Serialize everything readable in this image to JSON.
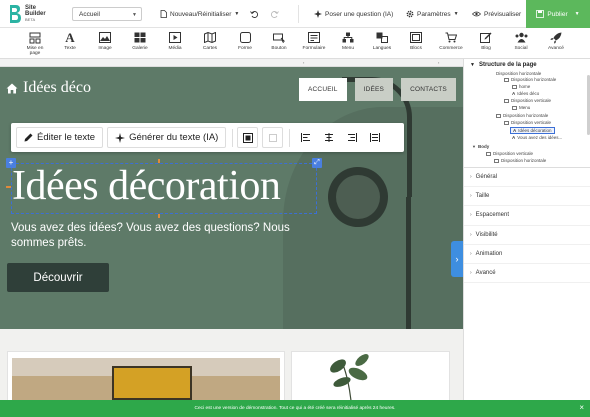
{
  "app": {
    "logo_line1": "Site",
    "logo_line2": "Builder",
    "logo_line3": "BETA"
  },
  "topbar": {
    "page_select": "Accueil",
    "new_reinit": "Nouveau/Réinitialiser",
    "ask_question": "Poser une question (IA)",
    "settings": "Paramètres",
    "preview": "Prévisualiser",
    "publish": "Publier"
  },
  "tools": [
    {
      "label": "Mise en page",
      "icon": "layout-icon"
    },
    {
      "label": "Texte",
      "icon": "text-icon"
    },
    {
      "label": "Image",
      "icon": "image-icon"
    },
    {
      "label": "Galerie",
      "icon": "gallery-icon"
    },
    {
      "label": "Média",
      "icon": "media-icon"
    },
    {
      "label": "Cartes",
      "icon": "map-icon"
    },
    {
      "label": "Forme",
      "icon": "shape-icon"
    },
    {
      "label": "Bouton",
      "icon": "button-icon"
    },
    {
      "label": "Formulaire",
      "icon": "form-icon"
    },
    {
      "label": "Menu",
      "icon": "menu-icon"
    },
    {
      "label": "Langues",
      "icon": "languages-icon"
    },
    {
      "label": "Blocs",
      "icon": "blocks-icon"
    },
    {
      "label": "Commerce",
      "icon": "cart-icon"
    },
    {
      "label": "Blog",
      "icon": "blog-icon"
    },
    {
      "label": "Social",
      "icon": "social-icon"
    },
    {
      "label": "Avancé",
      "icon": "rocket-icon"
    }
  ],
  "site": {
    "logo": "Idées déco",
    "nav": [
      "ACCUEIL",
      "IDÉES",
      "CONTACTS"
    ],
    "title": "Idées décoration",
    "subtitle": "Vous avez des idées? Vous avez des questions? Nous sommes prêts.",
    "cta": "Découvrir"
  },
  "text_toolbar": {
    "edit_text": "Éditer le texte",
    "generate_text": "Générer du texte (IA)"
  },
  "panel": {
    "title": "Structure de la page",
    "tree": [
      {
        "label": "Disposition horizontale",
        "indent": 0
      },
      {
        "label": "Disposition horizontale",
        "indent": 1
      },
      {
        "label": "home",
        "indent": 2
      },
      {
        "label": "Idées déco",
        "indent": 2
      },
      {
        "label": "Disposition verticale",
        "indent": 1
      },
      {
        "label": "Menu",
        "indent": 2
      },
      {
        "label": "Disposition horizontale",
        "indent": 0
      },
      {
        "label": "Disposition verticale",
        "indent": 1
      },
      {
        "label": "Idées décoration",
        "indent": 2,
        "selected": true
      },
      {
        "label": "Vous avez des idées...",
        "indent": 2
      },
      {
        "label": "Body",
        "indent": -1
      },
      {
        "label": "Disposition verticale",
        "indent": 0
      },
      {
        "label": "Disposition horizontale",
        "indent": 1
      }
    ],
    "sections": [
      "Général",
      "Taille",
      "Espacement",
      "Visibilité",
      "Animation",
      "Avancé"
    ]
  },
  "banner": {
    "text": "Ceci est une version de démonstration. Tout ce qui a été créé sera réinitialisé après 24 heures."
  },
  "colors": {
    "hero_green": "#5e7a68",
    "publish_green": "#5cb85c",
    "banner_green": "#2ea84a",
    "selection_blue": "#3b6fd6"
  }
}
